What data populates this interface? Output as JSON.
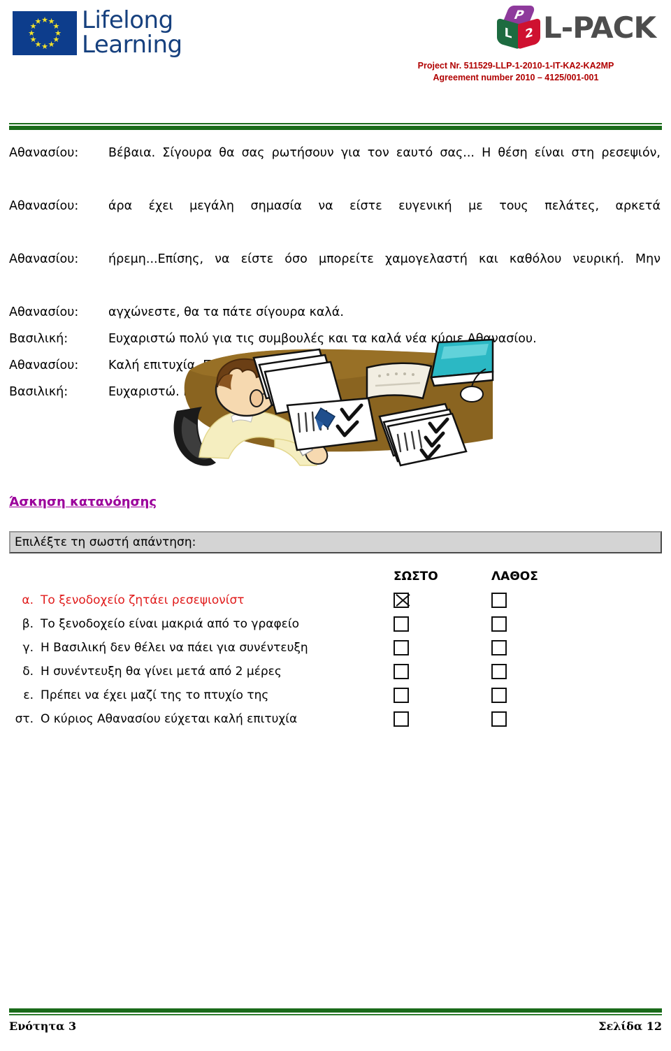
{
  "header": {
    "eu_logo": {
      "line1": "Lifelong",
      "line2": "Learning"
    },
    "lpack": {
      "cube_top": "P",
      "cube_left": "L",
      "cube_right": "2",
      "wordmark": "L-PACK"
    },
    "project_line1": "Project Nr. 511529-LLP-1-2010-1-IT-KA2-KA2MP",
    "project_line2": "Agreement number 2010 – 4125/001-001",
    "accent_green": "#1a6b1a",
    "project_red": "#b00000"
  },
  "dialogue": [
    {
      "speaker": "Αθανασίου:",
      "lines": [
        "Βέβαια. Σίγουρα θα σας ρωτήσουν για τον εαυτό σας... Η θέση είναι στη ρεσεψιόν,",
        "άρα έχει μεγάλη σημασία να είστε ευγενική με τους πελάτες, αρκετά",
        "ήρεμη...Επίσης, να είστε όσο μπορείτε χαμογελαστή και καθόλου νευρική.  Μην",
        "αγχώνεστε, θα τα πάτε σίγουρα καλά."
      ]
    },
    {
      "speaker": "Βασιλική:",
      "lines": [
        "Ευχαριστώ πολύ για τις συμβουλές και τα καλά νέα κύριε Αθανασίου."
      ]
    },
    {
      "speaker": "Αθανασίου:",
      "lines": [
        "Καλή επιτυχία. Πάντα στη διάθεση σας. Γεια σας."
      ]
    },
    {
      "speaker": "Βασιλική:",
      "lines": [
        "Ευχαριστώ. Γεια σας."
      ]
    }
  ],
  "illustration": {
    "alt": "man-at-desk-reviewing-checklists-illustration"
  },
  "exercise": {
    "heading": "Άσκηση κατανόησης",
    "heading_color": "#9b009b",
    "prompt": "Επιλέξτε τη σωστή απάντηση:",
    "columns": [
      "ΣΩΣΤΟ",
      "ΛΑΘΟΣ"
    ],
    "highlight_color": "#e01b1b",
    "items": [
      {
        "letter": "α.",
        "text": "Το ξενοδοχείο ζητάει ρεσεψιονίστ",
        "highlighted": true,
        "correct_checked": true,
        "wrong_checked": false
      },
      {
        "letter": "β.",
        "text": "Το ξενοδοχείο είναι μακριά από το γραφείο",
        "highlighted": false,
        "correct_checked": false,
        "wrong_checked": false
      },
      {
        "letter": "γ.",
        "text": "Η Βασιλική δεν θέλει να πάει για συνέντευξη",
        "highlighted": false,
        "correct_checked": false,
        "wrong_checked": false
      },
      {
        "letter": "δ.",
        "text": "Η συνέντευξη θα γίνει μετά από 2 μέρες",
        "highlighted": false,
        "correct_checked": false,
        "wrong_checked": false
      },
      {
        "letter": "ε.",
        "text": "Πρέπει να έχει μαζί της το πτυχίο της",
        "highlighted": false,
        "correct_checked": false,
        "wrong_checked": false
      },
      {
        "letter": "στ.",
        "text": "Ο κύριος Αθανασίου εύχεται καλή επιτυχία",
        "highlighted": false,
        "correct_checked": false,
        "wrong_checked": false
      }
    ]
  },
  "footer": {
    "left": "Ενότητα 3",
    "right": "Σελίδα 12"
  }
}
